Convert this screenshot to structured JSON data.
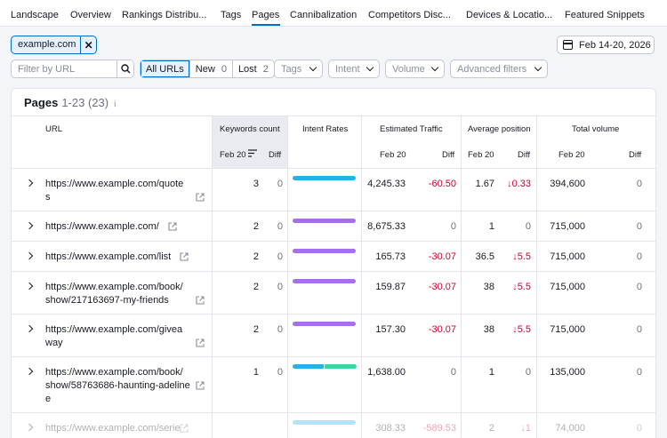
{
  "nav": {
    "tabs": [
      {
        "label": "Landscape"
      },
      {
        "label": "Overview"
      },
      {
        "label": "Rankings Distribu..."
      },
      {
        "label": "Tags"
      },
      {
        "label": "Pages"
      },
      {
        "label": "Cannibalization"
      },
      {
        "label": "Competitors Disc..."
      },
      {
        "label": "Devices & Locatio..."
      },
      {
        "label": "Featured Snippets"
      }
    ],
    "active": "Pages"
  },
  "filters": {
    "domain_chip": "example.com",
    "date_range": "Feb 14-20, 2026",
    "search_placeholder": "Filter by URL",
    "segments": [
      {
        "label": "All URLs",
        "count": ""
      },
      {
        "label": "New",
        "count": "0"
      },
      {
        "label": "Lost",
        "count": "2"
      }
    ],
    "dropdowns": [
      "Tags",
      "Intent",
      "Volume",
      "Advanced filters"
    ]
  },
  "card": {
    "title": "Pages",
    "range": "1-23",
    "total": "(23)",
    "info_icon": "i"
  },
  "columns": {
    "url": "URL",
    "keywords_count": "Keywords count",
    "intent_rates": "Intent Rates",
    "estimated_traffic": "Estimated Traffic",
    "average_position": "Average position",
    "total_volume": "Total volume",
    "date": "Feb 20",
    "diff": "Diff"
  },
  "colors": {
    "informational": "#29aee8",
    "commercial": "#a56fe8",
    "transactional": "#3fd4a0",
    "negative": "#d1002f",
    "accent": "#006dca"
  },
  "rows": [
    {
      "url_lines": [
        "https://www.example.com/quote",
        "s"
      ],
      "kw": "3",
      "kw_diff": "0",
      "intent": [
        {
          "type": "informational",
          "share": 1.0
        }
      ],
      "traffic": "4,245.33",
      "traffic_diff": "-60.50",
      "pos": "1.67",
      "pos_diff": "0.33",
      "pos_dir": "down",
      "volume": "394,600",
      "vol_diff": "0"
    },
    {
      "url_lines": [
        "https://www.example.com/"
      ],
      "kw": "2",
      "kw_diff": "0",
      "intent": [
        {
          "type": "commercial",
          "share": 1.0
        }
      ],
      "traffic": "8,675.33",
      "traffic_diff": "0",
      "pos": "1",
      "pos_diff": "0",
      "pos_dir": "",
      "volume": "715,000",
      "vol_diff": "0"
    },
    {
      "url_lines": [
        "https://www.example.com/list"
      ],
      "kw": "2",
      "kw_diff": "0",
      "intent": [
        {
          "type": "commercial",
          "share": 1.0
        }
      ],
      "traffic": "165.73",
      "traffic_diff": "-30.07",
      "pos": "36.5",
      "pos_diff": "5.5",
      "pos_dir": "down",
      "volume": "715,000",
      "vol_diff": "0"
    },
    {
      "url_lines": [
        "https://www.example.com/book/",
        "show/217163697-my-friends"
      ],
      "kw": "2",
      "kw_diff": "0",
      "intent": [
        {
          "type": "commercial",
          "share": 1.0
        }
      ],
      "traffic": "159.87",
      "traffic_diff": "-30.07",
      "pos": "38",
      "pos_diff": "5.5",
      "pos_dir": "down",
      "volume": "715,000",
      "vol_diff": "0"
    },
    {
      "url_lines": [
        "https://www.example.com/givea",
        "way"
      ],
      "kw": "2",
      "kw_diff": "0",
      "intent": [
        {
          "type": "commercial",
          "share": 1.0
        }
      ],
      "traffic": "157.30",
      "traffic_diff": "-30.07",
      "pos": "38",
      "pos_diff": "5.5",
      "pos_dir": "down",
      "volume": "715,000",
      "vol_diff": "0"
    },
    {
      "url_lines": [
        "https://www.example.com/book/",
        "show/58763686-haunting-adeline",
        "e"
      ],
      "kw": "1",
      "kw_diff": "0",
      "intent": [
        {
          "type": "informational",
          "share": 0.5
        },
        {
          "type": "transactional",
          "share": 0.5
        }
      ],
      "traffic": "1,638.00",
      "traffic_diff": "0",
      "pos": "1",
      "pos_diff": "0",
      "pos_dir": "",
      "volume": "135,000",
      "vol_diff": "0"
    },
    {
      "url_lines": [
        "https://www.example.com/serie"
      ],
      "kw": "",
      "kw_diff": "",
      "intent": [
        {
          "type": "informational",
          "share": 1.0
        }
      ],
      "traffic": "308.33",
      "traffic_diff": "-589.53",
      "pos": "2",
      "pos_diff": "1",
      "pos_dir": "down",
      "volume": "74,000",
      "vol_diff": "0"
    }
  ]
}
